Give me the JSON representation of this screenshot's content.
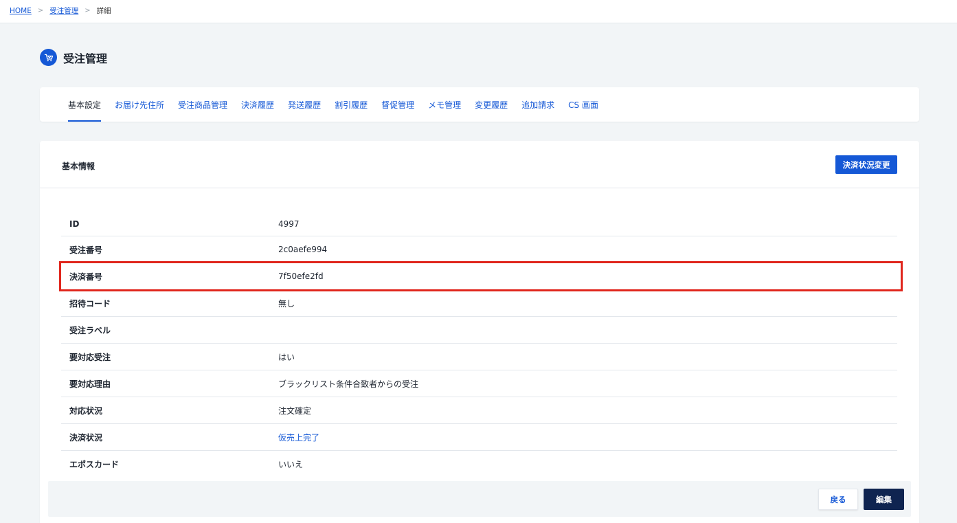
{
  "breadcrumb": {
    "home": "HOME",
    "separator": ">",
    "orders": "受注管理",
    "current": "詳細"
  },
  "page": {
    "title": "受注管理",
    "icon": "cart-icon"
  },
  "tabs": [
    {
      "label": "基本設定",
      "active": true
    },
    {
      "label": "お届け先住所",
      "active": false
    },
    {
      "label": "受注商品管理",
      "active": false
    },
    {
      "label": "決済履歴",
      "active": false
    },
    {
      "label": "発送履歴",
      "active": false
    },
    {
      "label": "割引履歴",
      "active": false
    },
    {
      "label": "督促管理",
      "active": false
    },
    {
      "label": "メモ管理",
      "active": false
    },
    {
      "label": "変更履歴",
      "active": false
    },
    {
      "label": "追加請求",
      "active": false
    },
    {
      "label": "CS 画面",
      "active": false
    }
  ],
  "card": {
    "title": "基本情報",
    "action_button": "決済状況変更"
  },
  "rows": [
    {
      "label": "ID",
      "value": "4997"
    },
    {
      "label": "受注番号",
      "value": "2c0aefe994"
    },
    {
      "label": "決済番号",
      "value": "7f50efe2fd",
      "highlighted": true
    },
    {
      "label": "招待コード",
      "value": "無し"
    },
    {
      "label": "受注ラベル",
      "value": ""
    },
    {
      "label": "要対応受注",
      "value": "はい"
    },
    {
      "label": "要対応理由",
      "value": "ブラックリスト条件合致者からの受注"
    },
    {
      "label": "対応状況",
      "value": "注文確定"
    },
    {
      "label": "決済状況",
      "value": "仮売上完了",
      "link": true
    },
    {
      "label": "エポスカード",
      "value": "いいえ"
    }
  ],
  "footer": {
    "back_label": "戻る",
    "edit_label": "編集"
  },
  "colors": {
    "primary": "#1558d6",
    "dark": "#0f2450",
    "highlight": "#e0261d",
    "background": "#f2f5f7"
  }
}
